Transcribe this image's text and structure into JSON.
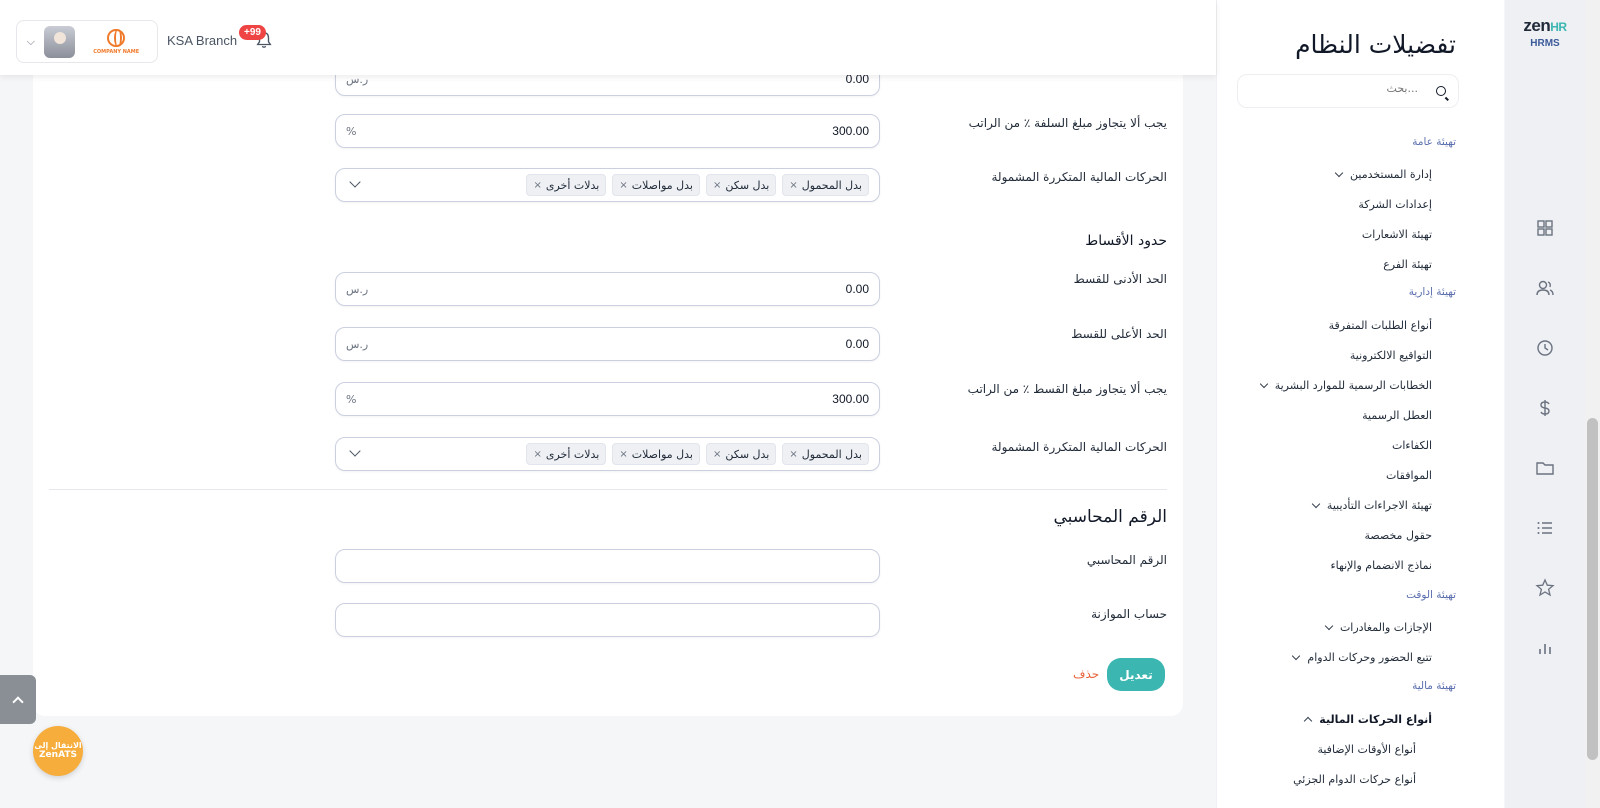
{
  "topbar": {
    "branch": "KSA Branch",
    "notifications_badge": "+99",
    "company_logo_text": "COMPANY NAME"
  },
  "form": {
    "row0": {
      "value": "0.00",
      "unit": "ر.س"
    },
    "advance_max_pct": {
      "label": "يجب ألا يتجاوز مبلغ السلفة ٪ من الراتب",
      "value": "300.00",
      "unit": "%"
    },
    "advance_recurring": {
      "label": "الحركات المالية المتكررة المشمولة",
      "tags": [
        "بدل المحمول",
        "بدل سكن",
        "بدل مواصلات",
        "بدلات أخرى"
      ]
    },
    "installments_title": "حدود الأقساط",
    "installment_min": {
      "label": "الحد الأدنى للقسط",
      "value": "0.00",
      "unit": "ر.س"
    },
    "installment_max": {
      "label": "الحد الأعلى للقسط",
      "value": "0.00",
      "unit": "ر.س"
    },
    "installment_max_pct": {
      "label": "يجب ألا يتجاوز مبلغ القسط ٪ من الراتب",
      "value": "300.00",
      "unit": "%"
    },
    "installment_recurring": {
      "label": "الحركات المالية المتكررة المشمولة",
      "tags": [
        "بدل المحمول",
        "بدل سكن",
        "بدل مواصلات",
        "بدلات أخرى"
      ]
    },
    "accounting_title": "الرقم المحاسبي",
    "accounting_number": {
      "label": "الرقم المحاسبي",
      "value": ""
    },
    "budget_account": {
      "label": "حساب الموازنة",
      "value": ""
    },
    "edit_button": "تعديل",
    "delete_button": "حذف",
    "tag_remove": "×"
  },
  "zenats": {
    "line1": "الانتقال إلى",
    "line2": "ZenATS"
  },
  "settings": {
    "title": "تفضيلات النظام",
    "search_placeholder": "بحث...",
    "groups": {
      "general": "تهيئة عامة",
      "admin": "تهيئة إدارية",
      "time": "تهيئة الوقت",
      "financial": "تهيئة مالية"
    },
    "items": {
      "user_management": "إدارة المستخدمين",
      "company_settings": "إعدادات الشركة",
      "notifications_setup": "تهيئة الاشعارات",
      "branch_setup": "تهيئة الفرع",
      "misc_requests": "أنواع الطلبات المتفرقة",
      "e_signatures": "التواقيع الالكترونية",
      "hr_letters": "الخطابات الرسمية للموارد البشرية",
      "holidays": "العطل الرسمية",
      "competencies": "الكفاءات",
      "approvals": "الموافقات",
      "disciplinary": "تهيئة الاجراءات التأديبية",
      "custom_fields": "حقول مخصصة",
      "onboarding_templates": "نماذج الانضمام والإنهاء",
      "leaves": "الإجازات والمغادرات",
      "attendance": "تتبع الحضور وحركات الدوام",
      "financial_types": "أنواع الحركات المالية",
      "overtime_types": "أنواع الأوقات الإضافية",
      "partial_types": "أنواع حركات الدوام الجزئي"
    }
  },
  "brand": {
    "logo_main": "zen",
    "logo_accent": "HR",
    "product": "HRMS"
  },
  "colors": {
    "accent": "#3bb6b0",
    "delete": "#e8623a",
    "badge": "#ef4444",
    "group_label": "#5b6fae"
  }
}
